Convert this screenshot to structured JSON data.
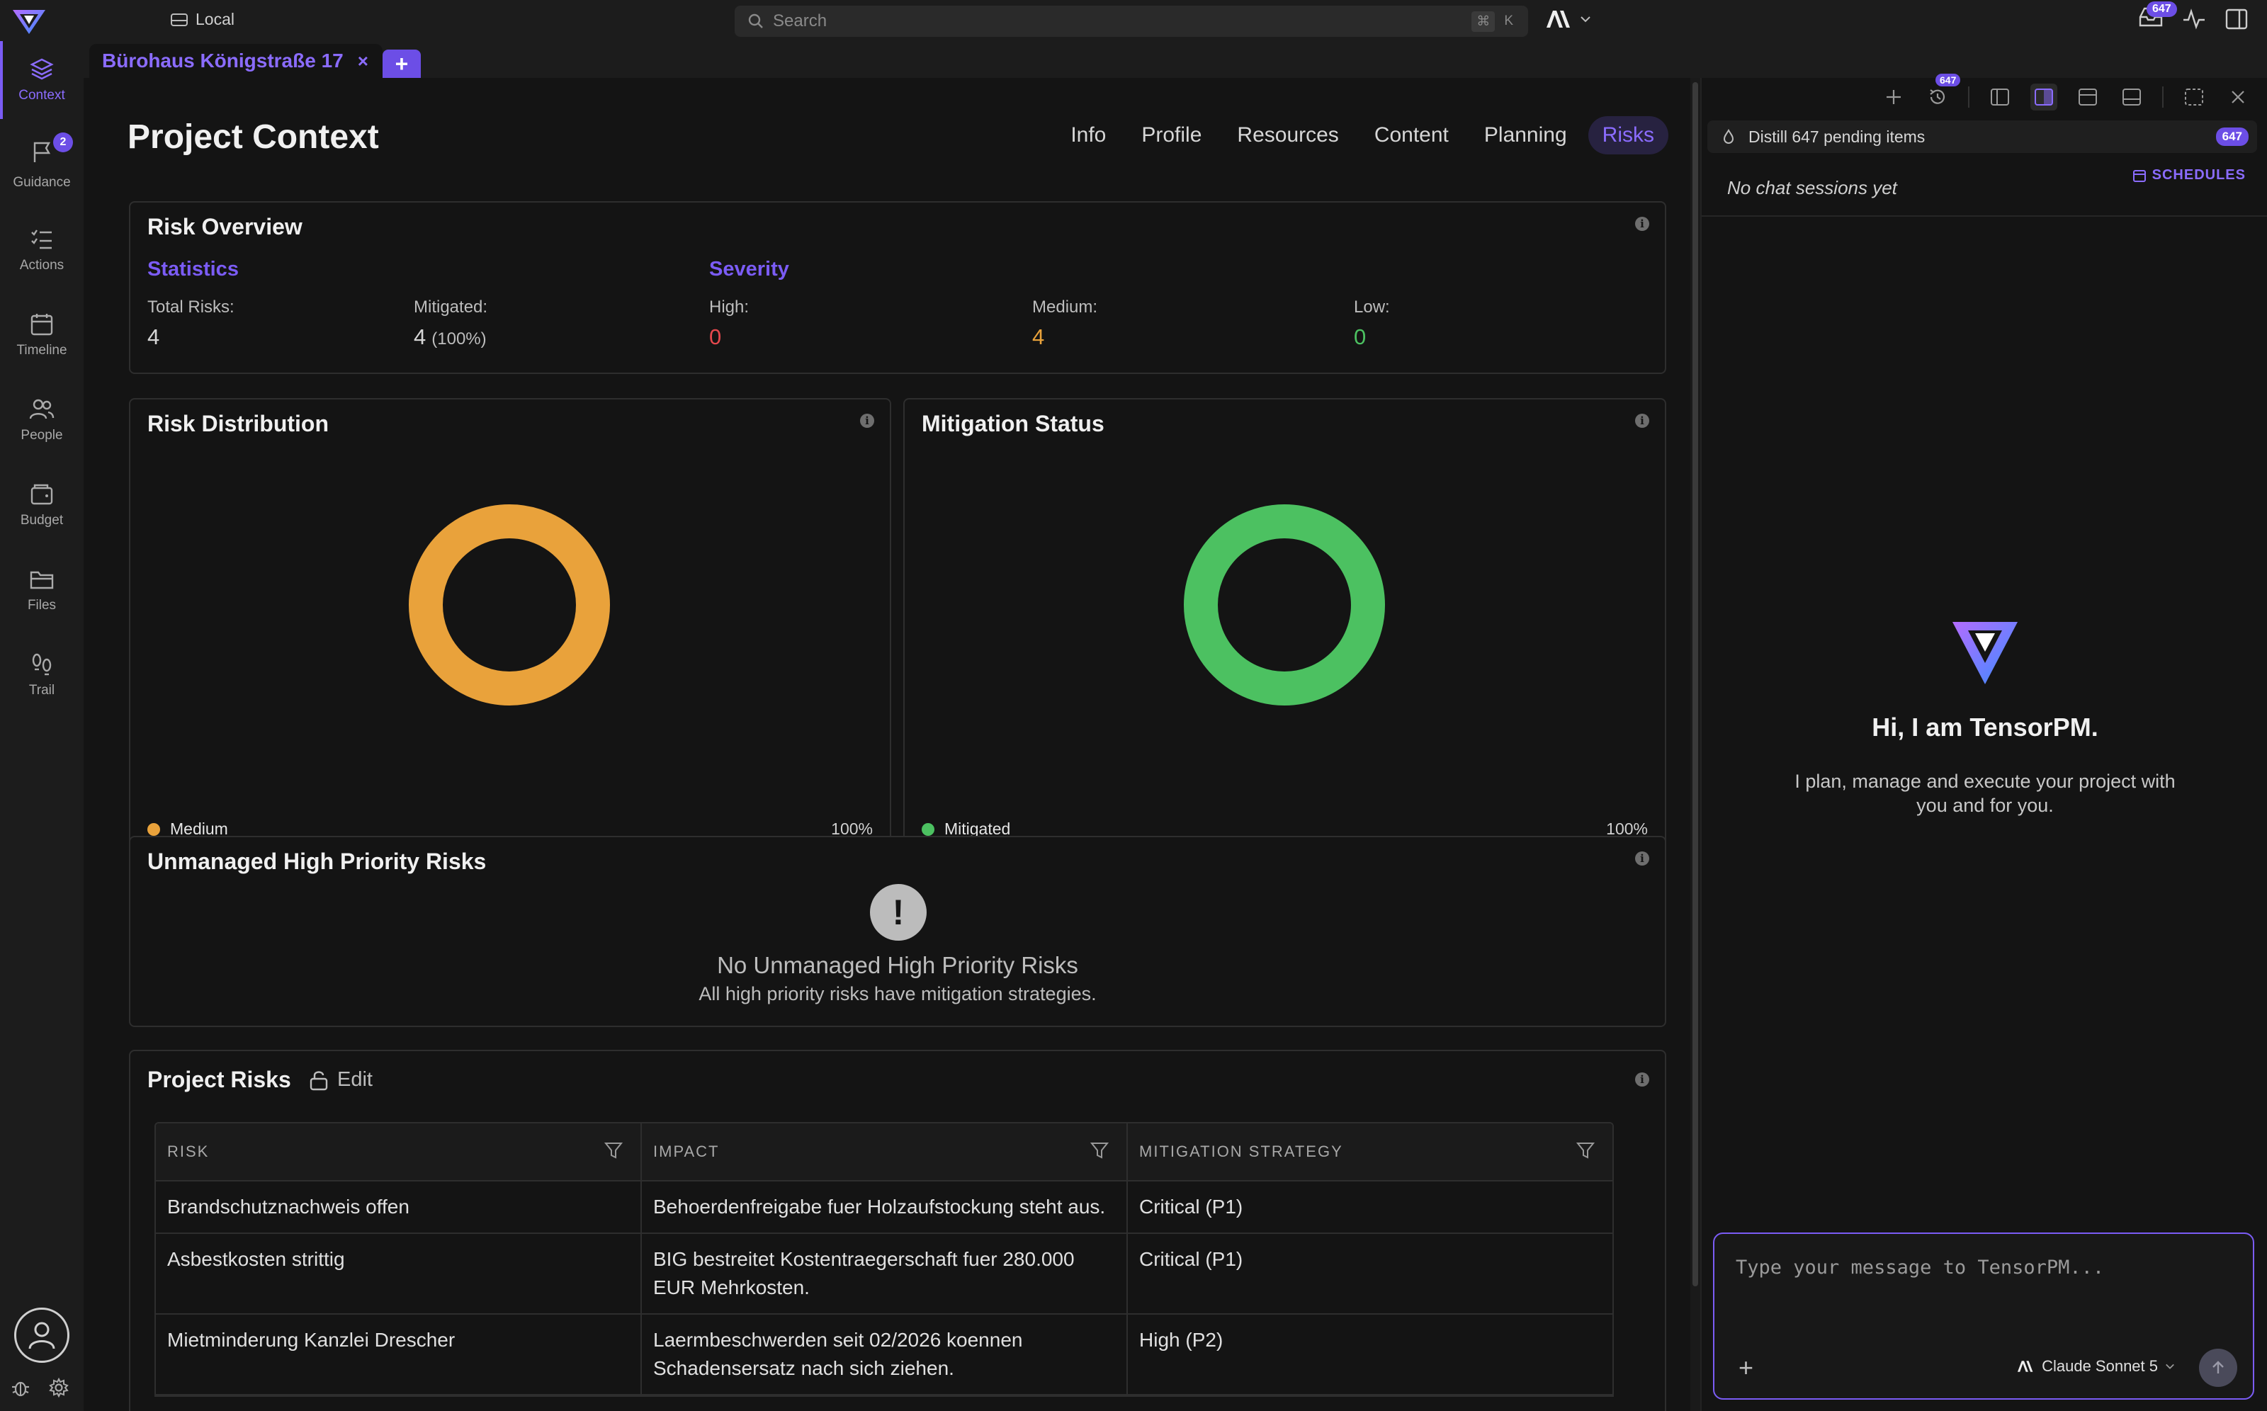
{
  "topbar": {
    "location": "Local",
    "search_placeholder": "Search",
    "shortcut_cmd": "⌘",
    "shortcut_key": "K",
    "inbox_count": "647"
  },
  "sidebar": {
    "items": [
      {
        "label": "Context",
        "icon": "layers-icon",
        "active": true
      },
      {
        "label": "Guidance",
        "icon": "flag-icon",
        "badge": "2"
      },
      {
        "label": "Actions",
        "icon": "checklist-icon"
      },
      {
        "label": "Timeline",
        "icon": "calendar-icon"
      },
      {
        "label": "People",
        "icon": "people-icon"
      },
      {
        "label": "Budget",
        "icon": "wallet-icon"
      },
      {
        "label": "Files",
        "icon": "folder-icon"
      },
      {
        "label": "Trail",
        "icon": "footprints-icon"
      }
    ]
  },
  "tabs": {
    "project_tab": "Bürohaus Königstraße 17",
    "close": "×",
    "add": "+"
  },
  "main": {
    "title": "Project Context",
    "nav": [
      "Info",
      "Profile",
      "Resources",
      "Content",
      "Planning",
      "Risks"
    ],
    "active_nav": "Risks",
    "overview": {
      "title": "Risk Overview",
      "statistics_h": "Statistics",
      "severity_h": "Severity",
      "total_label": "Total Risks:",
      "total_value": "4",
      "mitigated_label": "Mitigated:",
      "mitigated_value": "4",
      "mitigated_pct": "(100%)",
      "high_label": "High:",
      "high_value": "0",
      "medium_label": "Medium:",
      "medium_value": "4",
      "low_label": "Low:",
      "low_value": "0"
    },
    "distribution": {
      "title": "Risk Distribution",
      "legend_label": "Medium",
      "legend_pct": "100%",
      "color": "#E9A23B"
    },
    "mitigation": {
      "title": "Mitigation Status",
      "legend_label": "Mitigated",
      "legend_pct": "100%",
      "color": "#4CC161"
    },
    "unmanaged": {
      "title": "Unmanaged High Priority Risks",
      "empty_title": "No Unmanaged High Priority Risks",
      "empty_sub": "All high priority risks have mitigation strategies."
    },
    "project_risks": {
      "title": "Project Risks",
      "edit_label": "Edit",
      "columns": [
        "RISK",
        "IMPACT",
        "MITIGATION STRATEGY"
      ],
      "rows": [
        [
          "Brandschutznachweis offen",
          "Behoerdenfreigabe fuer Holzaufstockung steht aus.",
          "Critical (P1)"
        ],
        [
          "Asbestkosten strittig",
          "BIG bestreitet Kostentraegerschaft fuer 280.000 EUR Mehrkosten.",
          "Critical (P1)"
        ],
        [
          "Mietminderung Kanzlei Drescher",
          "Laermbeschwerden seit 02/2026 koennen Schadensersatz nach sich ziehen.",
          "High (P2)"
        ]
      ]
    }
  },
  "chart_data": [
    {
      "type": "pie",
      "title": "Risk Distribution",
      "labels": [
        "Medium"
      ],
      "values": [
        100
      ],
      "colors": [
        "#E9A23B"
      ]
    },
    {
      "type": "pie",
      "title": "Mitigation Status",
      "labels": [
        "Mitigated"
      ],
      "values": [
        100
      ],
      "colors": [
        "#4CC161"
      ]
    }
  ],
  "right_panel": {
    "toolbar_badge": "647",
    "distill_label": "Distill 647 pending items",
    "distill_count": "647",
    "no_sessions": "No chat sessions yet",
    "schedules": "SCHEDULES",
    "hero_title": "Hi, I am TensorPM.",
    "hero_sub": "I plan, manage and execute your project with you and for you.",
    "chat_placeholder": "Type your message to TensorPM...",
    "model": "Claude Sonnet 5"
  },
  "colors": {
    "accent": "#7B5CF5",
    "high": "#E5484D",
    "medium": "#E9A23B",
    "low": "#4CC161"
  }
}
